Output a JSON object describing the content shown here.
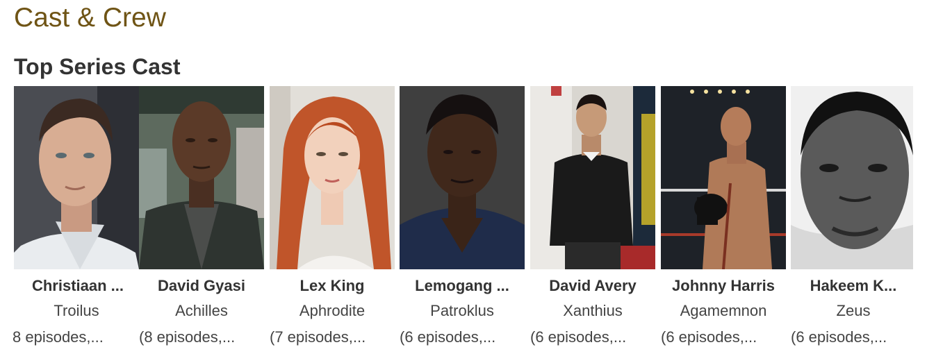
{
  "section": {
    "title": "Cast & Crew",
    "subtitle": "Top Series Cast"
  },
  "cast": [
    {
      "name": "Christiaan ...",
      "character": "Troilus",
      "episodes": "8 episodes,..."
    },
    {
      "name": "David Gyasi",
      "character": "Achilles",
      "episodes": "(8 episodes,..."
    },
    {
      "name": "Lex King",
      "character": "Aphrodite",
      "episodes": "(7 episodes,..."
    },
    {
      "name": "Lemogang ...",
      "character": "Patroklus",
      "episodes": "(6 episodes,..."
    },
    {
      "name": "David Avery",
      "character": "Xanthius",
      "episodes": "(6 episodes,..."
    },
    {
      "name": "Johnny Harris",
      "character": "Agamemnon",
      "episodes": "(6 episodes,..."
    },
    {
      "name": "Hakeem K...",
      "character": "Zeus",
      "episodes": "(6 episodes,..."
    }
  ],
  "colors": {
    "section_title": "#6f5415",
    "text": "#333333"
  }
}
